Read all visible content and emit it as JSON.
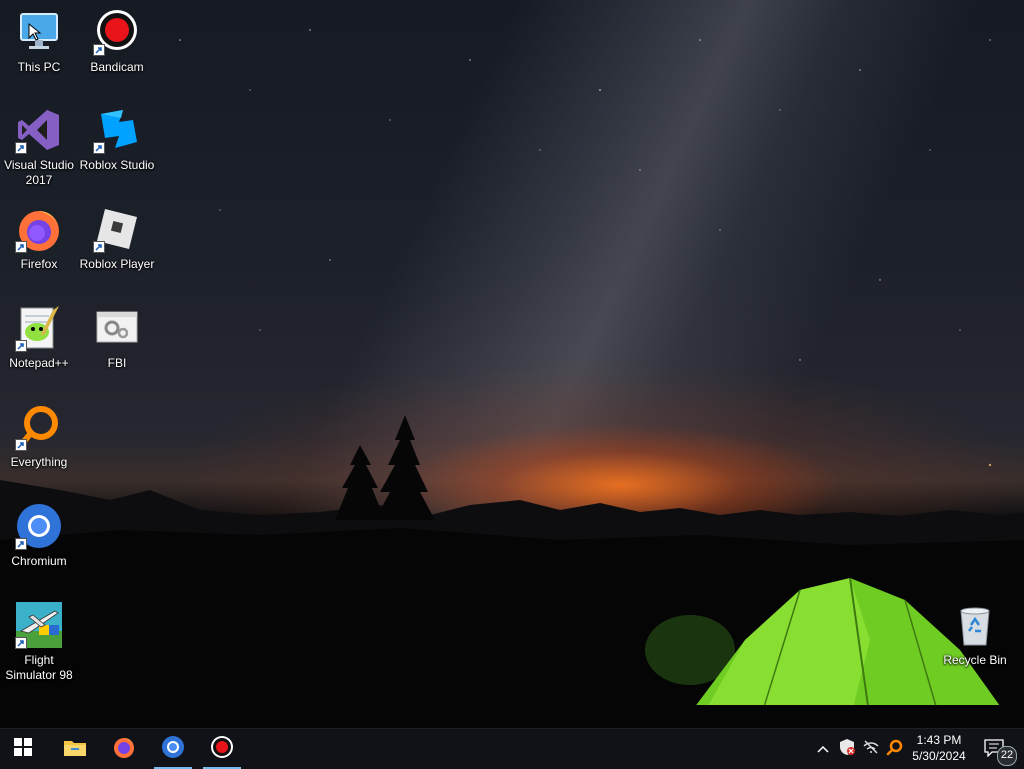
{
  "desktop": {
    "icons": [
      {
        "name": "This PC",
        "icon": "this-pc-icon"
      },
      {
        "name": "Bandicam",
        "icon": "bandicam-icon"
      },
      {
        "name": "Visual Studio 2017",
        "icon": "visual-studio-icon"
      },
      {
        "name": "Roblox Studio",
        "icon": "roblox-studio-icon"
      },
      {
        "name": "Firefox",
        "icon": "firefox-icon"
      },
      {
        "name": "Roblox Player",
        "icon": "roblox-player-icon"
      },
      {
        "name": "Notepad++",
        "icon": "notepadpp-icon"
      },
      {
        "name": "FBI",
        "icon": "fbi-icon"
      },
      {
        "name": "Everything",
        "icon": "everything-icon"
      },
      {
        "name": "Chromium",
        "icon": "chromium-icon"
      },
      {
        "name": "Flight Simulator 98",
        "icon": "flight-simulator-icon"
      },
      {
        "name": "Recycle Bin",
        "icon": "recycle-bin-icon"
      }
    ]
  },
  "taskbar": {
    "start": "windows-start-icon",
    "pinned": [
      {
        "name": "File Explorer",
        "icon": "folder-icon"
      },
      {
        "name": "Firefox",
        "icon": "firefox-icon"
      },
      {
        "name": "Chromium",
        "icon": "chromium-icon"
      },
      {
        "name": "Bandicam",
        "icon": "bandicam-icon"
      }
    ],
    "tray": {
      "time": "1:43 PM",
      "date": "5/30/2024",
      "notification_count": "22"
    }
  },
  "colors": {
    "taskbar": "#101218",
    "active_indicator": "#76b9ed",
    "tent_green": "#7bdc2a",
    "sunset_orange": "#ff7a1e"
  }
}
